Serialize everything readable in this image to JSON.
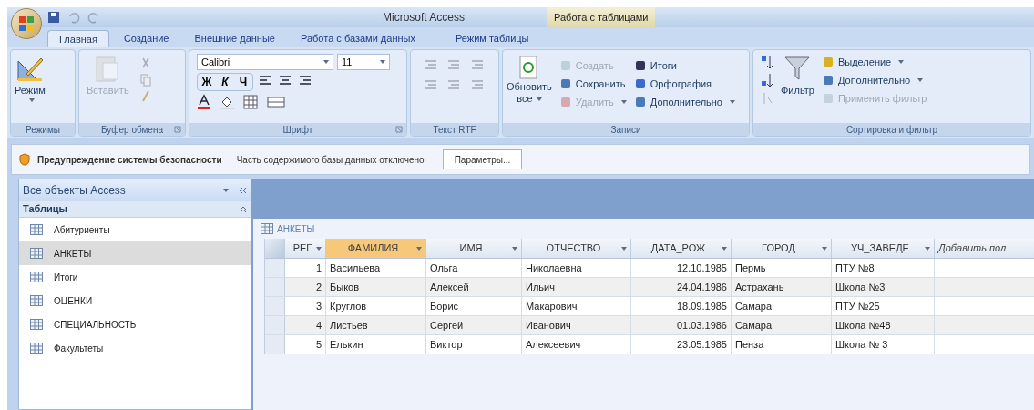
{
  "window": {
    "title": "Microsoft Access",
    "context_title": "Работа с таблицами"
  },
  "tabs": [
    {
      "label": "Главная",
      "selected": true,
      "kind": "main"
    },
    {
      "label": "Создание",
      "selected": false,
      "kind": "main"
    },
    {
      "label": "Внешние данные",
      "selected": false,
      "kind": "main"
    },
    {
      "label": "Работа с базами данных",
      "selected": false,
      "kind": "main"
    },
    {
      "label": "Режим таблицы",
      "selected": false,
      "kind": "context"
    }
  ],
  "ribbon": {
    "groups": [
      {
        "kind": "views",
        "label": "Режимы",
        "button": {
          "label": "Режим",
          "disabled": false
        }
      },
      {
        "kind": "clipboard",
        "label": "Буфер обмена",
        "button": {
          "label": "Вставить",
          "disabled": true
        }
      },
      {
        "kind": "font",
        "label": "Шрифт",
        "font": "Calibri",
        "size": "11",
        "styles": [
          "Ж",
          "К",
          "Ч"
        ]
      },
      {
        "kind": "rtf",
        "label": "Текст RTF"
      },
      {
        "kind": "records",
        "label": "Записи",
        "button": {
          "label": "Обновить",
          "sub": "все",
          "disabled": false
        },
        "items": [
          {
            "label": "Создать",
            "disabled": true,
            "menu": false
          },
          {
            "label": "Сохранить",
            "disabled": false,
            "menu": false
          },
          {
            "label": "Удалить",
            "disabled": true,
            "menu": true
          },
          {
            "label": "Итоги",
            "disabled": false,
            "menu": false
          },
          {
            "label": "Орфография",
            "disabled": false,
            "menu": false
          },
          {
            "label": "Дополнительно",
            "disabled": false,
            "menu": true
          }
        ]
      },
      {
        "kind": "sort",
        "label": "Сортировка и фильтр",
        "button": {
          "label": "Фильтр",
          "disabled": false
        },
        "items": [
          {
            "label": "Выделение",
            "disabled": false,
            "menu": true
          },
          {
            "label": "Дополнительно",
            "disabled": false,
            "menu": true
          },
          {
            "label": "Применить фильтр",
            "disabled": true,
            "menu": false
          }
        ]
      }
    ]
  },
  "security_bar": {
    "title": "Предупреждение системы безопасности",
    "message": "Часть содержимого базы данных отключено",
    "button": "Параметры..."
  },
  "nav": {
    "title": "Все объекты Access",
    "section": "Таблицы",
    "items": [
      {
        "label": "Абитуриенты",
        "selected": false
      },
      {
        "label": "АНКЕТЫ",
        "selected": true
      },
      {
        "label": "Итоги",
        "selected": false
      },
      {
        "label": "ОЦЕНКИ",
        "selected": false
      },
      {
        "label": "СПЕЦИАЛЬНОСТЬ",
        "selected": false
      },
      {
        "label": "Факультеты",
        "selected": false
      }
    ]
  },
  "table": {
    "title": "АНКЕТЫ",
    "columns": [
      {
        "label": "РЕГ",
        "selected": false,
        "numeric": true
      },
      {
        "label": "ФАМИЛИЯ",
        "selected": true,
        "numeric": false
      },
      {
        "label": "ИМЯ",
        "selected": false,
        "numeric": false
      },
      {
        "label": "ОТЧЕСТВО",
        "selected": false,
        "numeric": false
      },
      {
        "label": "ДАТА_РОЖ",
        "selected": false,
        "numeric": true
      },
      {
        "label": "ГОРОД",
        "selected": false,
        "numeric": false
      },
      {
        "label": "УЧ_ЗАВЕДЕ",
        "selected": false,
        "numeric": false
      }
    ],
    "add_column": "Добавить пол",
    "rows": [
      [
        "1",
        "Васильева",
        "Ольга",
        "Николаевна",
        "12.10.1985",
        "Пермь",
        "ПТУ №8"
      ],
      [
        "2",
        "Быков",
        "Алексей",
        "Ильич",
        "24.04.1986",
        "Астрахань",
        "Школа №3"
      ],
      [
        "3",
        "Круглов",
        "Борис",
        "Макарович",
        "18.09.1985",
        "Самара",
        "ПТУ №25"
      ],
      [
        "4",
        "Листьев",
        "Сергей",
        "Иванович",
        "01.03.1986",
        "Самара",
        "Школа №48"
      ],
      [
        "5",
        "Елькин",
        "Виктор",
        "Алексеевич",
        "23.05.1985",
        "Пенза",
        "Школа № 3"
      ]
    ]
  }
}
